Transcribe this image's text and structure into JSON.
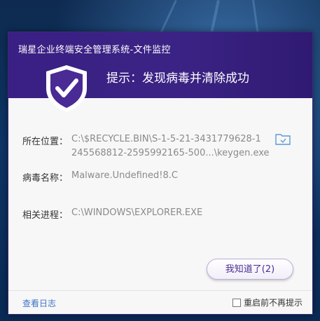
{
  "window": {
    "title": "瑞星企业终端安全管理系统-文件监控"
  },
  "banner": {
    "message": "提示：发现病毒并清除成功",
    "icon": "shield-check-icon"
  },
  "details": {
    "location_label": "所在位置：",
    "location_value_line1": "C:\\$RECYCLE.BIN\\S-1-5-21-3431779628-1",
    "location_value_line2": "245568812-2595992165-500...\\keygen.exe",
    "virus_label": "病毒名称：",
    "virus_value": "Malware.Undefined!8.C",
    "process_label": "相关进程：",
    "process_value": "C:\\WINDOWS\\EXPLORER.EXE"
  },
  "actions": {
    "ok_label": "我知道了(2)",
    "view_log_label": "查看日志",
    "no_remind_label": "重启前不再提示",
    "no_remind_checked": false
  },
  "colors": {
    "header": "#3a1f84",
    "accent": "#4b2d93",
    "link": "#3f74c7"
  }
}
